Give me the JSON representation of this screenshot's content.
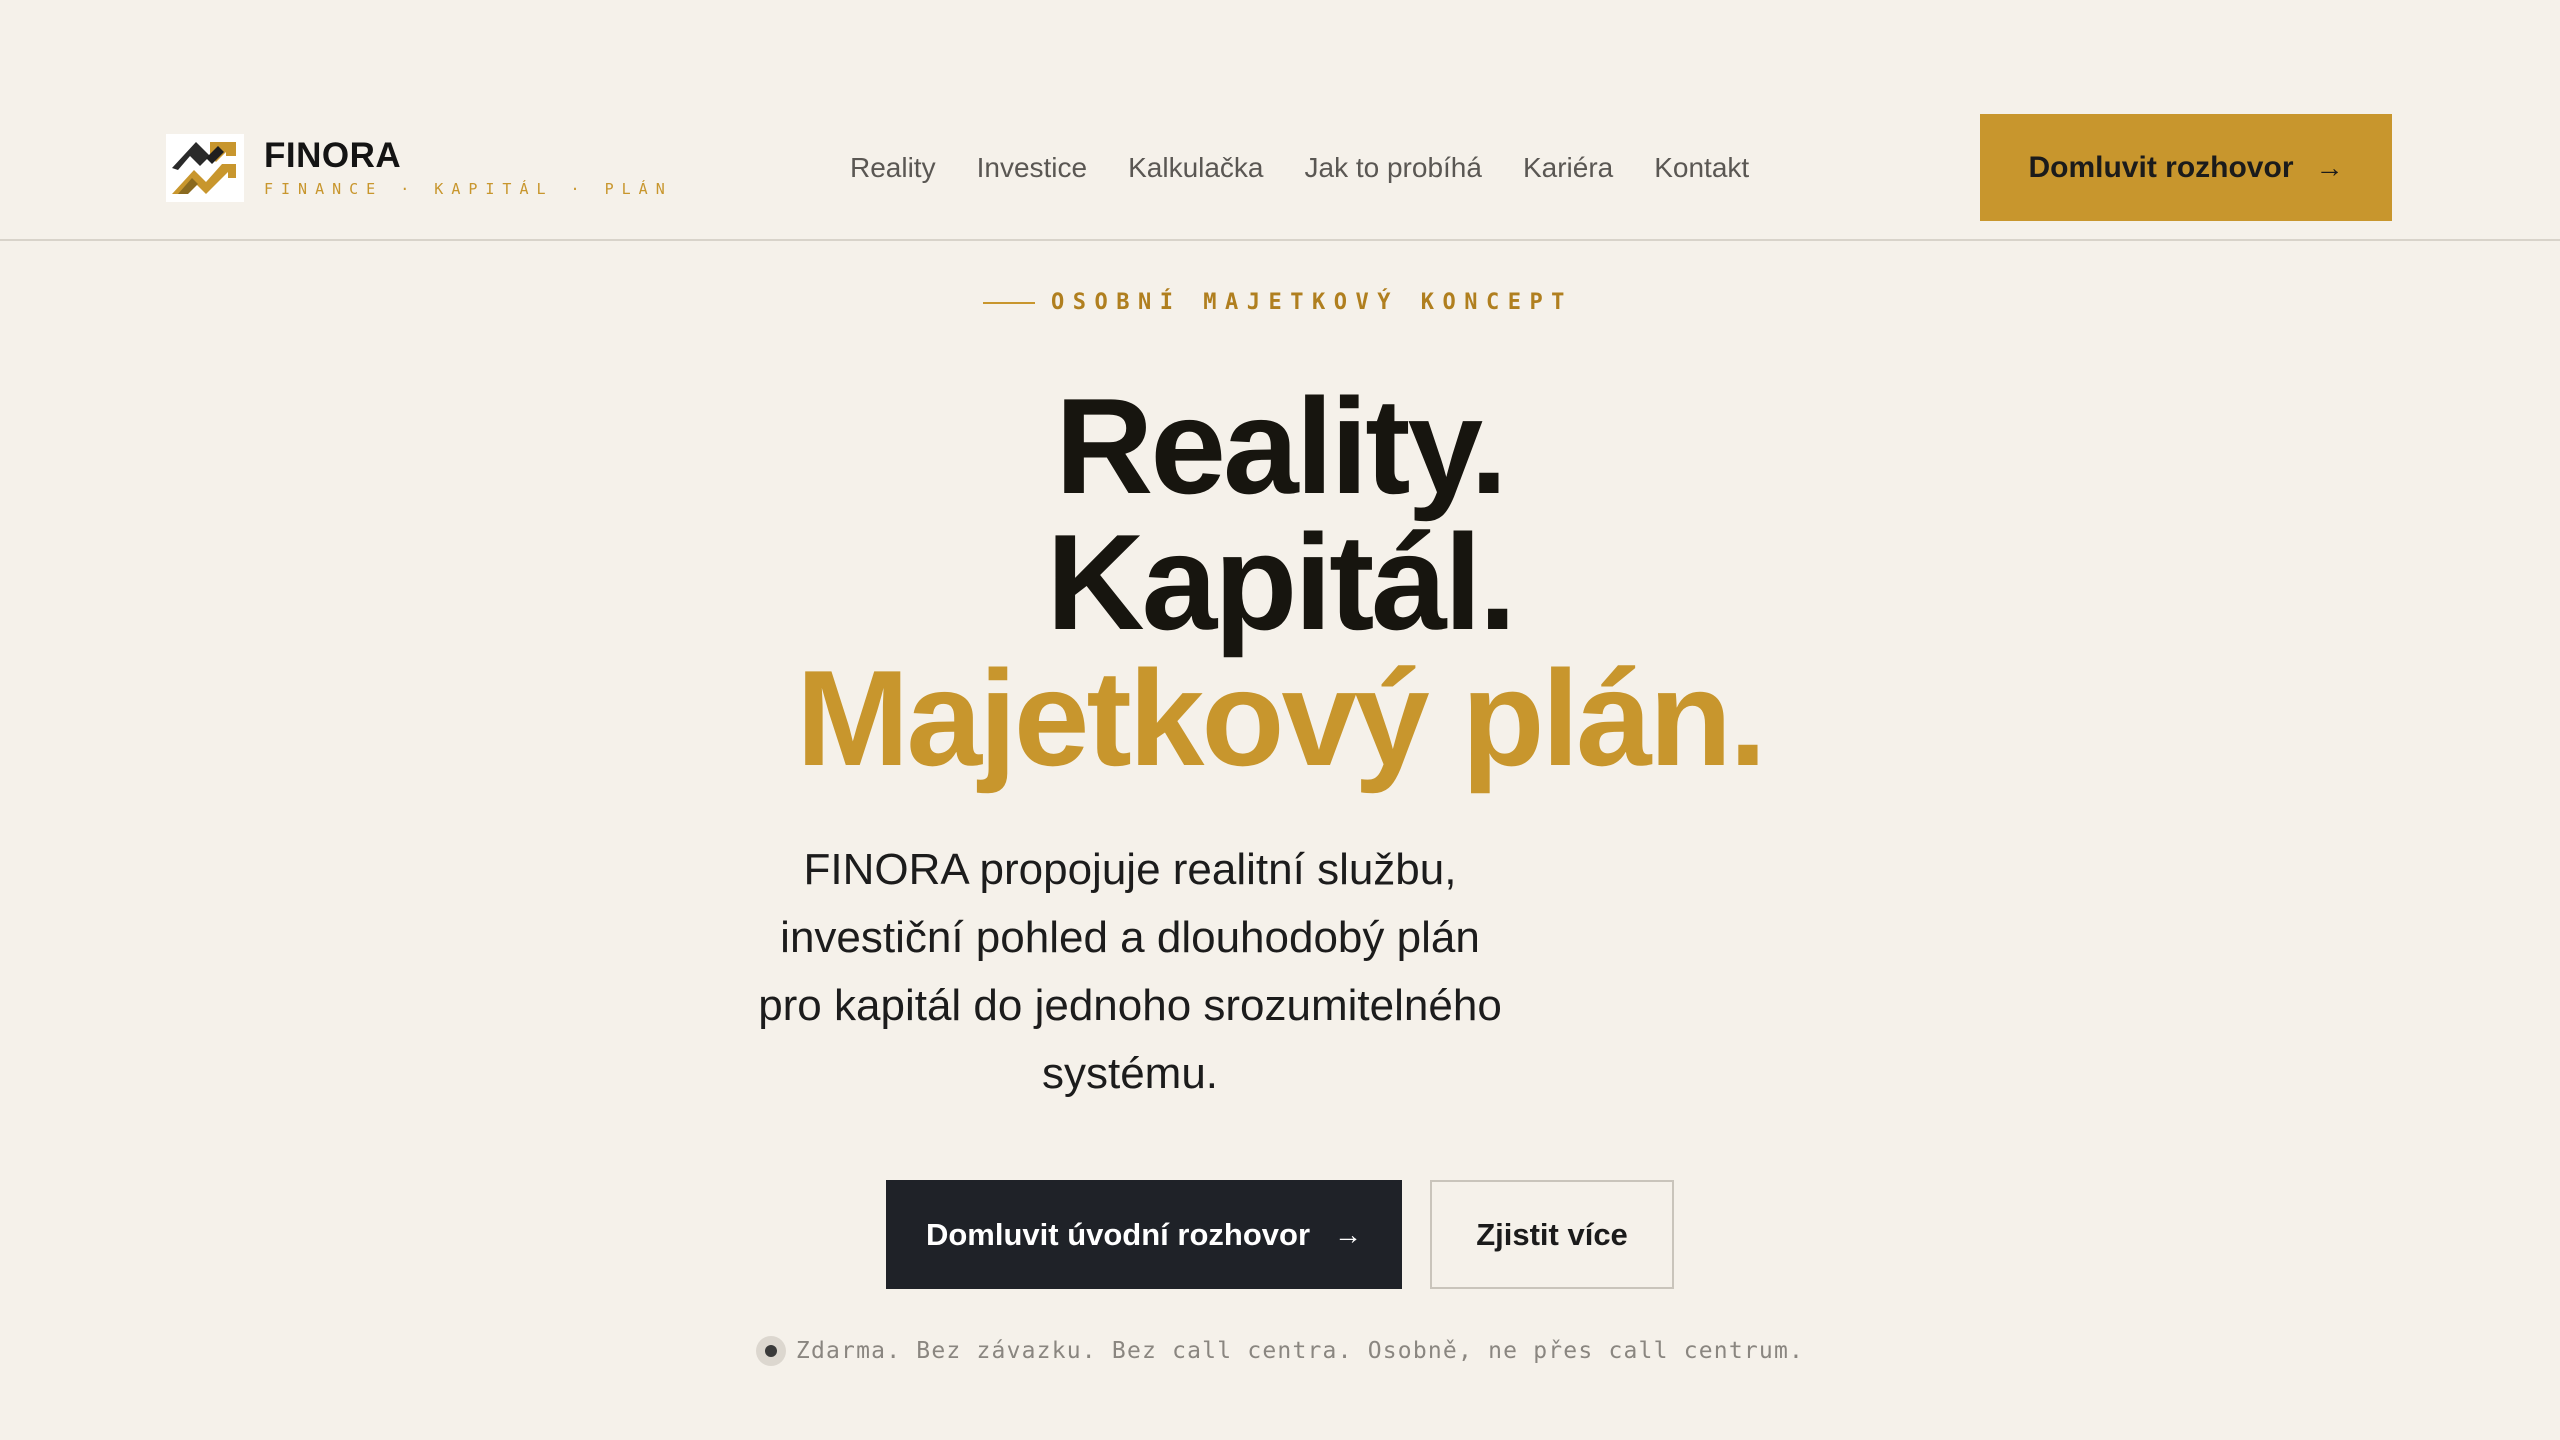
{
  "brand": {
    "name": "FINORA",
    "tagline": "FINANCE · KAPITÁL · PLÁN"
  },
  "nav": {
    "items": [
      {
        "label": "Reality"
      },
      {
        "label": "Investice"
      },
      {
        "label": "Kalkulačka"
      },
      {
        "label": "Jak to probíhá"
      },
      {
        "label": "Kariéra"
      },
      {
        "label": "Kontakt"
      }
    ]
  },
  "header_cta": {
    "label": "Domluvit rozhovor",
    "icon": "arrow-right-icon"
  },
  "hero": {
    "eyebrow": "OSOBNÍ MAJETKOVÝ KONCEPT",
    "headline_line1": "Reality.",
    "headline_line2": "Kapitál.",
    "headline_line3": "Majetkový plán.",
    "lead": "FINORA propojuje realitní službu, investiční pohled a dlouhodobý plán pro kapitál do jednoho srozumitelného systému.",
    "primary_button": "Domluvit úvodní rozhovor",
    "secondary_button": "Zjistit více",
    "footnote": "Zdarma. Bez závazku. Bez call centra. Osobně, ne přes call centrum."
  },
  "colors": {
    "background": "#f5f1ea",
    "accent_gold": "#c8962d",
    "dark": "#1f2228",
    "text": "#141414"
  }
}
